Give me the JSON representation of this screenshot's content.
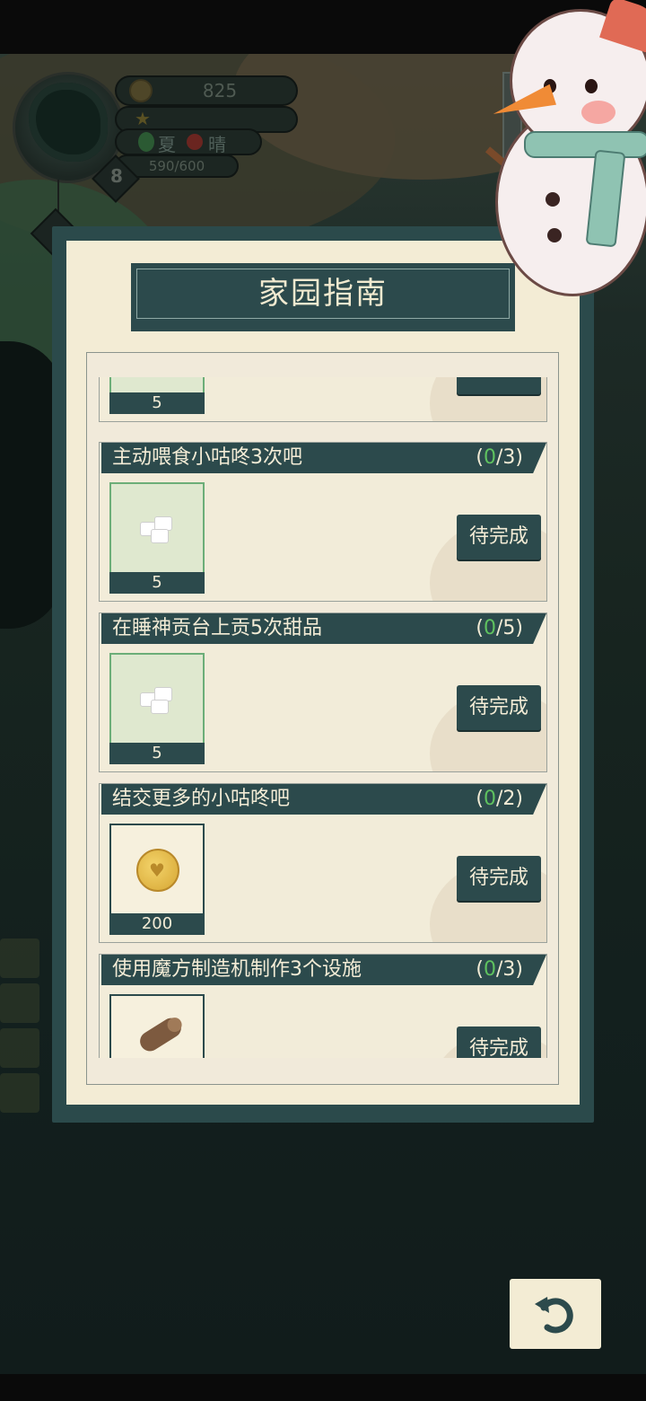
{
  "hud": {
    "coins": "825",
    "season": "夏",
    "weather": "晴",
    "energy": "590/600",
    "level": "8"
  },
  "panel": {
    "title": "家园指南"
  },
  "tasks": [
    {
      "description": "",
      "progress_current": "",
      "progress_total": "",
      "reward_icon": "sugar-cube-icon",
      "reward_qty": "5",
      "button": ""
    },
    {
      "description": "主动喂食小咕咚3次吧",
      "progress_open": "(",
      "progress_current": "0",
      "progress_total": "/3)",
      "reward_icon": "sugar-cube-icon",
      "reward_qty": "5",
      "button": "待完成"
    },
    {
      "description": "在睡神贡台上贡5次甜品",
      "progress_open": "(",
      "progress_current": "0",
      "progress_total": "/5)",
      "reward_icon": "sugar-cube-icon",
      "reward_qty": "5",
      "button": "待完成"
    },
    {
      "description": "结交更多的小咕咚吧",
      "progress_open": "(",
      "progress_current": "0",
      "progress_total": "/2)",
      "reward_icon": "gold-coin-icon",
      "reward_qty": "200",
      "button": "待完成"
    },
    {
      "description": "使用魔方制造机制作3个设施",
      "progress_open": "(",
      "progress_current": "0",
      "progress_total": "/3)",
      "reward_icon": "wood-log-icon",
      "reward_qty": "",
      "button": "待完成"
    }
  ],
  "colors": {
    "panel_dark": "#2c4a4c",
    "panel_light": "#f3ecd5",
    "progress_current": "#5fc25f"
  },
  "back_button_icon": "undo-arrow-icon"
}
